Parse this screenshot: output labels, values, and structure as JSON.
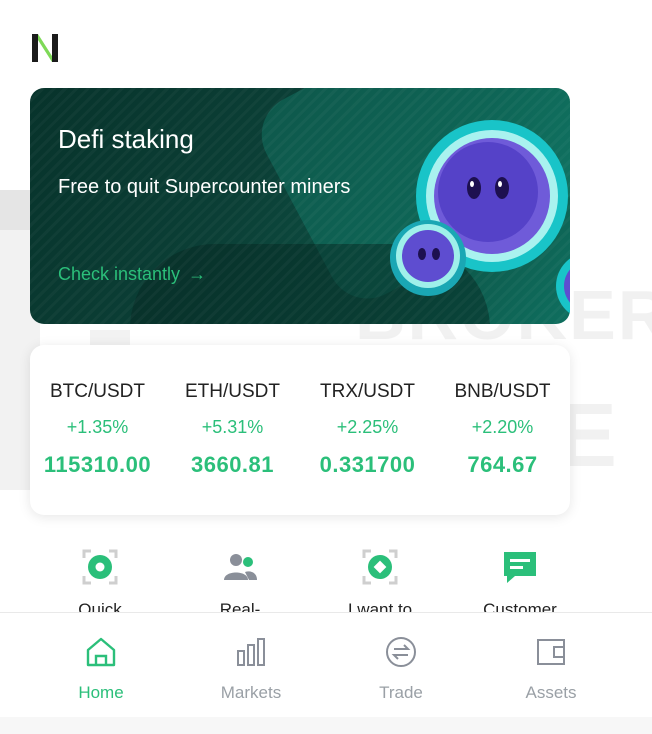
{
  "banner": {
    "title": "Defi staking",
    "subtitle": "Free to quit Supercounter miners",
    "link_label": "Check instantly",
    "link_arrow": "→"
  },
  "watermark": {
    "line1": "BROKER",
    "line2": "TRIBUNE"
  },
  "tickers": [
    {
      "pair": "BTC/USDT",
      "change": "+1.35%",
      "price": "115310.00"
    },
    {
      "pair": "ETH/USDT",
      "change": "+5.31%",
      "price": "3660.81"
    },
    {
      "pair": "TRX/USDT",
      "change": "+2.25%",
      "price": "0.331700"
    },
    {
      "pair": "BNB/USDT",
      "change": "+2.20%",
      "price": "764.67"
    }
  ],
  "shortcuts": [
    {
      "label": "Quick",
      "icon": "quick-buy-icon"
    },
    {
      "label": "Real-",
      "icon": "users-icon"
    },
    {
      "label": "I want to",
      "icon": "circle-target-icon"
    },
    {
      "label": "Customer",
      "icon": "chat-icon"
    }
  ],
  "nav": [
    {
      "label": "Home",
      "icon": "home-icon",
      "active": true
    },
    {
      "label": "Markets",
      "icon": "bar-chart-icon",
      "active": false
    },
    {
      "label": "Trade",
      "icon": "exchange-icon",
      "active": false
    },
    {
      "label": "Assets",
      "icon": "wallet-icon",
      "active": false
    }
  ],
  "colors": {
    "accent": "#2bbf7a",
    "banner_dark": "#07332b",
    "nav_inactive": "#9aa0a6"
  }
}
